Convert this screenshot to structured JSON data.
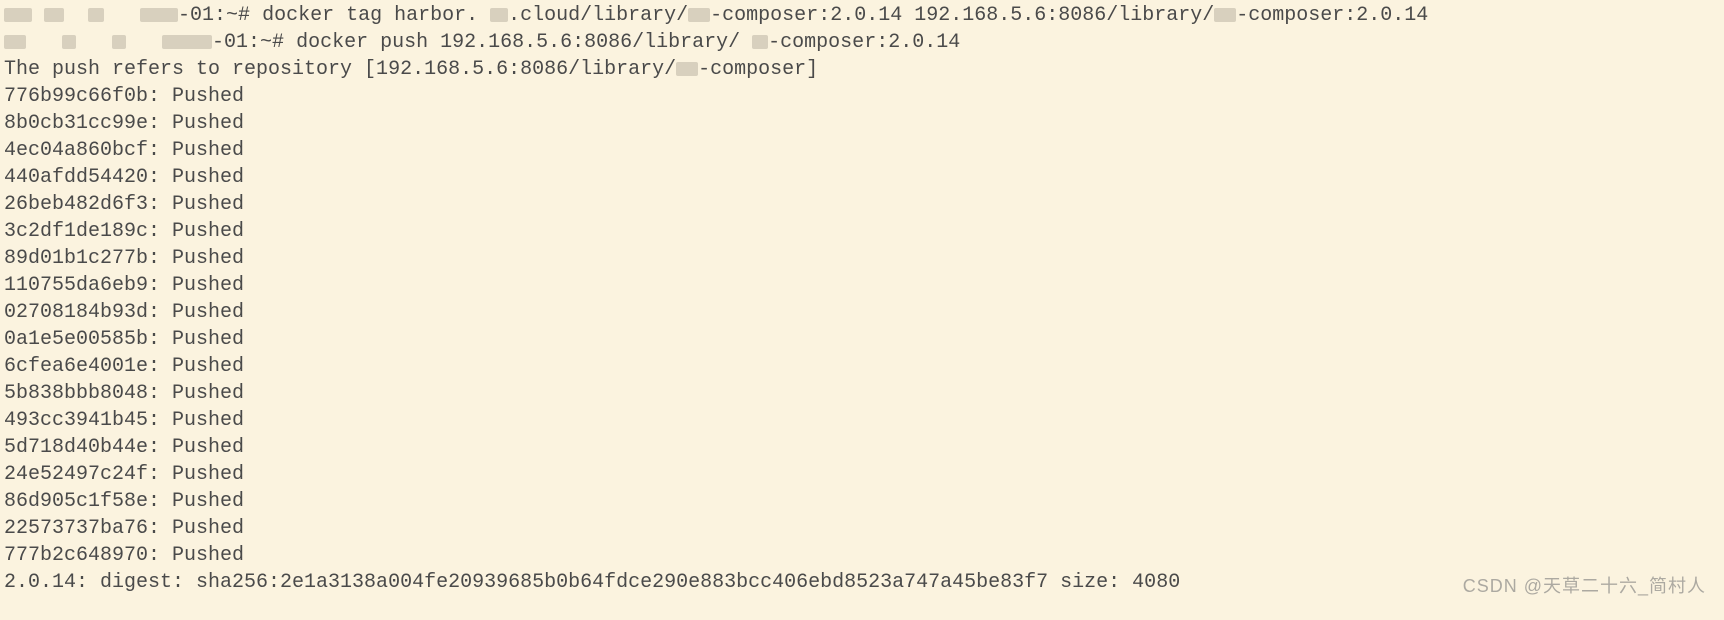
{
  "prompt1": {
    "host": "-01:~#",
    "cmd": "docker tag harbor.",
    "cloud": ".cloud/library/",
    "comp1": "-composer:2.0.14 192.168.5.6:8086/library/",
    "comp2": "-composer:2.0.14"
  },
  "prompt2": {
    "host": "-01:~#",
    "cmd": "docker push 192.168.5.6:8086/library/",
    "suffix": "-composer:2.0.14"
  },
  "push_refers_prefix": "The push refers to repository [192.168.5.6:8086/library/",
  "push_refers_suffix": "-composer]",
  "layers": [
    {
      "id": "776b99c66f0b",
      "status": "Pushed"
    },
    {
      "id": "8b0cb31cc99e",
      "status": "Pushed"
    },
    {
      "id": "4ec04a860bcf",
      "status": "Pushed"
    },
    {
      "id": "440afdd54420",
      "status": "Pushed"
    },
    {
      "id": "26beb482d6f3",
      "status": "Pushed"
    },
    {
      "id": "3c2df1de189c",
      "status": "Pushed"
    },
    {
      "id": "89d01b1c277b",
      "status": "Pushed"
    },
    {
      "id": "110755da6eb9",
      "status": "Pushed"
    },
    {
      "id": "02708184b93d",
      "status": "Pushed"
    },
    {
      "id": "0a1e5e00585b",
      "status": "Pushed"
    },
    {
      "id": "6cfea6e4001e",
      "status": "Pushed"
    },
    {
      "id": "5b838bbb8048",
      "status": "Pushed"
    },
    {
      "id": "493cc3941b45",
      "status": "Pushed"
    },
    {
      "id": "5d718d40b44e",
      "status": "Pushed"
    },
    {
      "id": "24e52497c24f",
      "status": "Pushed"
    },
    {
      "id": "86d905c1f58e",
      "status": "Pushed"
    },
    {
      "id": "22573737ba76",
      "status": "Pushed"
    },
    {
      "id": "777b2c648970",
      "status": "Pushed"
    }
  ],
  "digest_line": "2.0.14: digest: sha256:2e1a3138a004fe20939685b0b64fdce290e883bcc406ebd8523a747a45be83f7 size: 4080",
  "watermark": "CSDN @天草二十六_简村人"
}
